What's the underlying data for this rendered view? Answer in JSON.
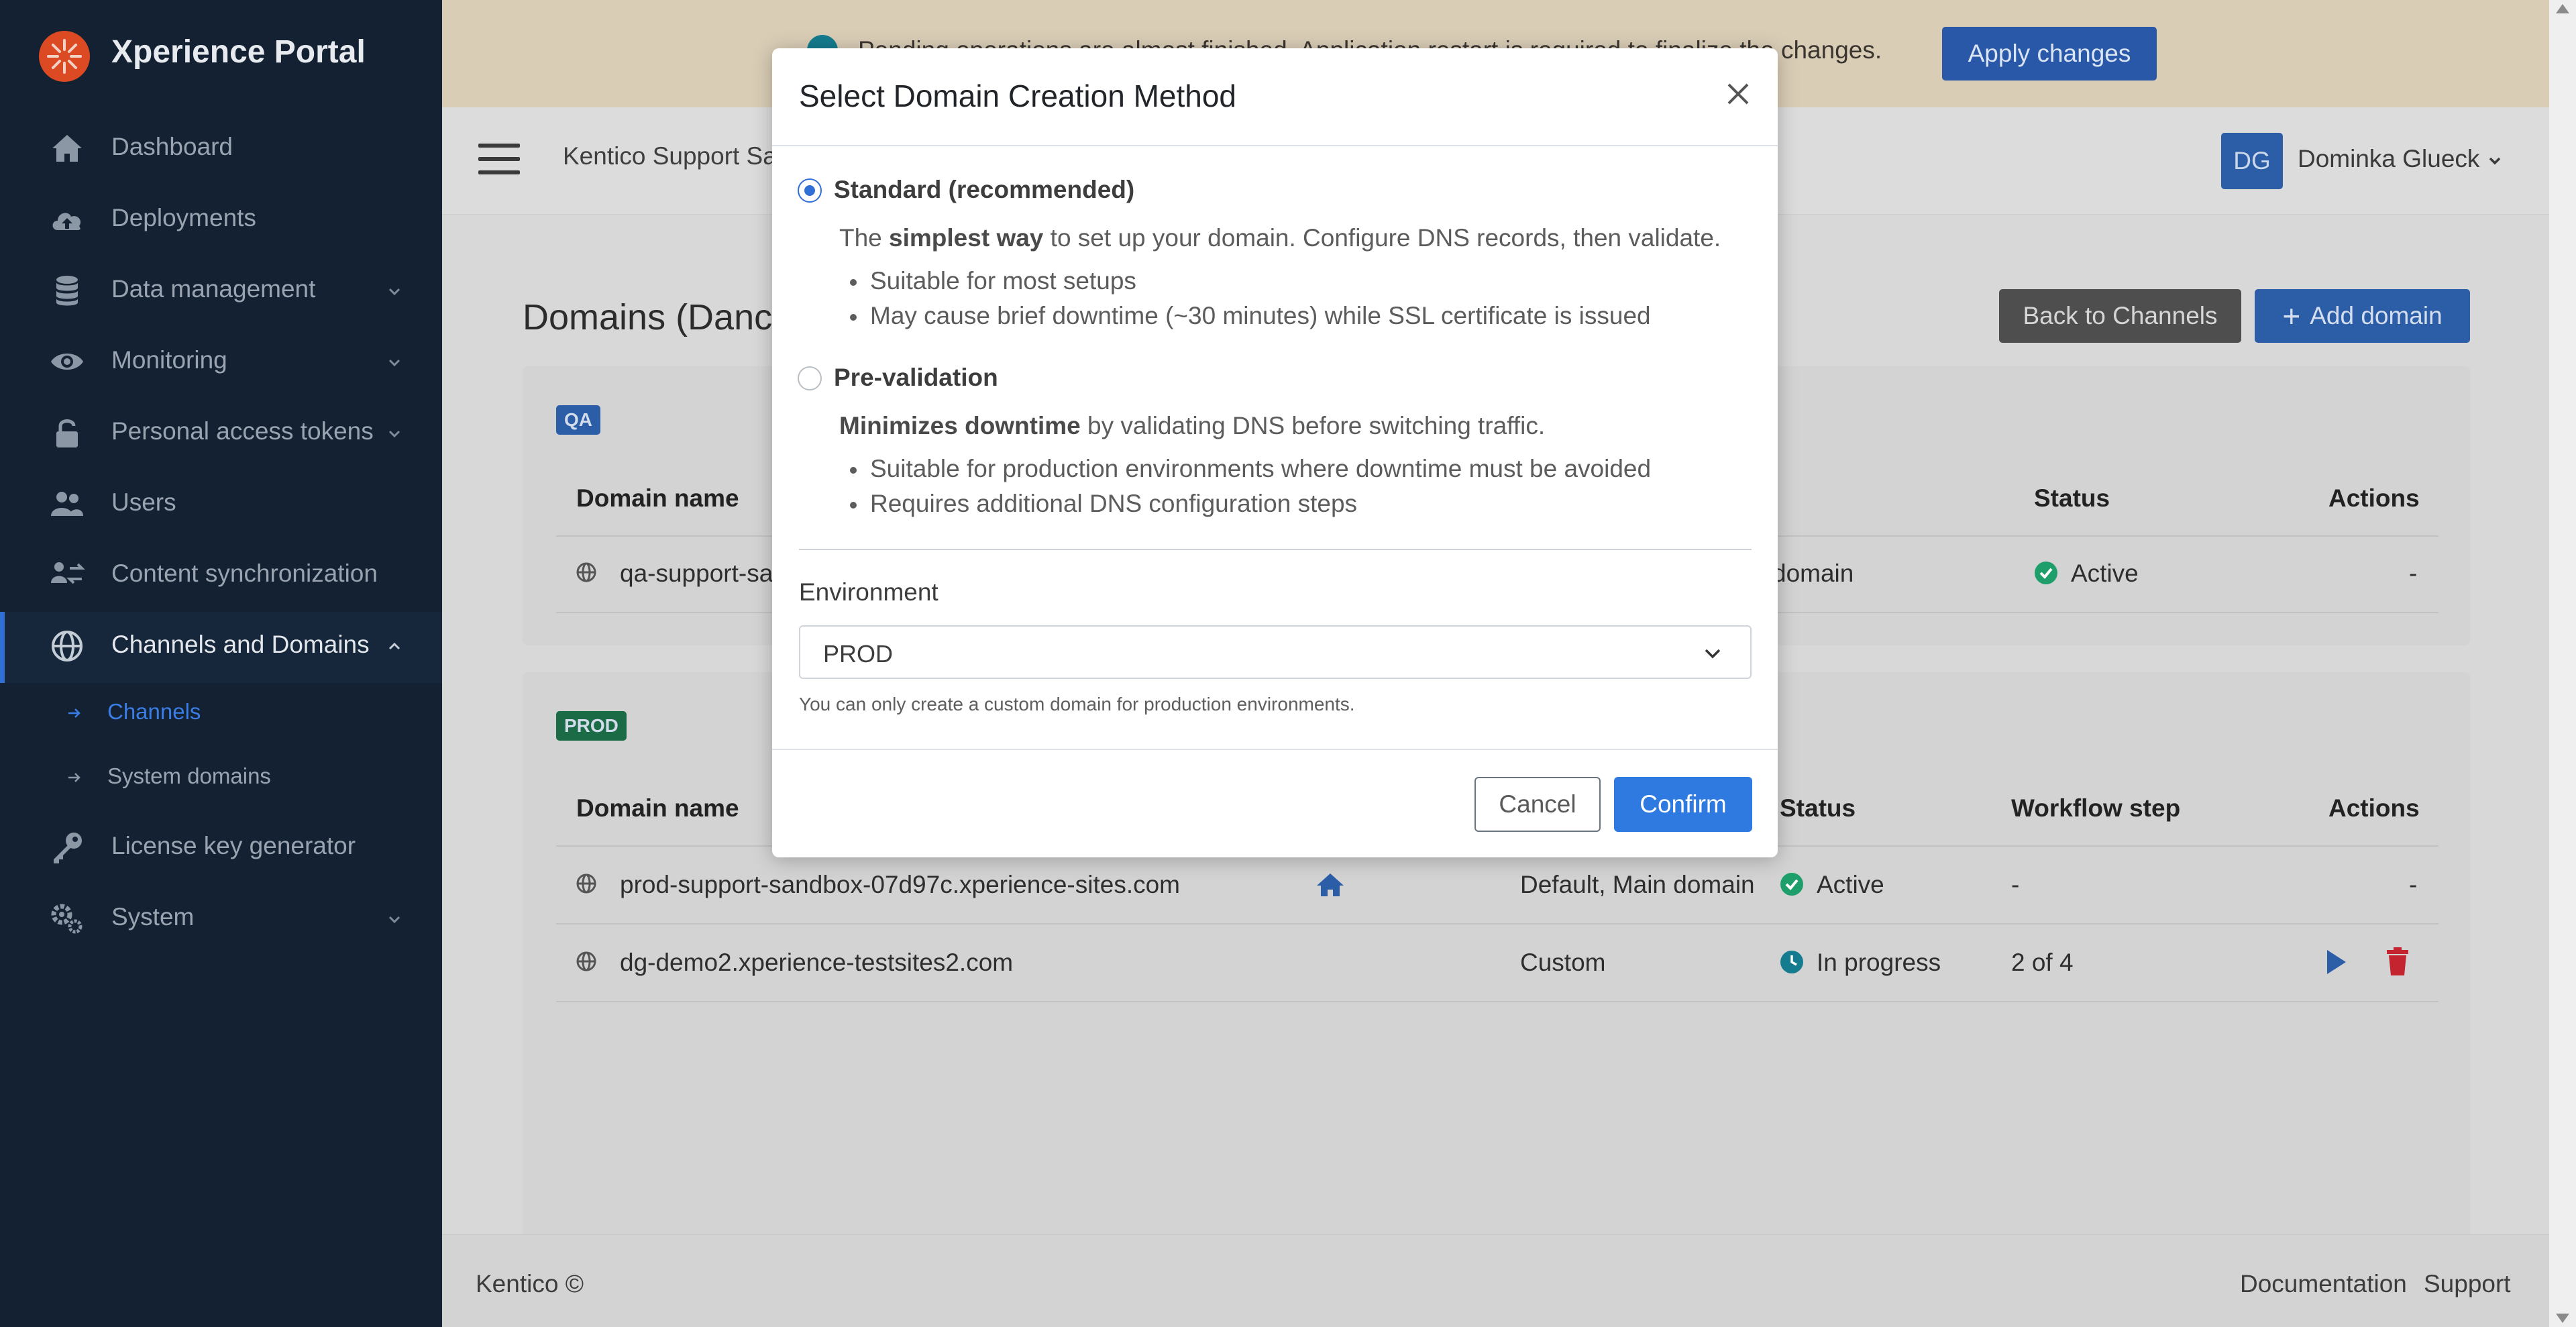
{
  "app": {
    "title": "Xperience Portal"
  },
  "sidebar": {
    "items": [
      {
        "label": "Dashboard",
        "icon": "home-icon"
      },
      {
        "label": "Deployments",
        "icon": "cloud-upload-icon"
      },
      {
        "label": "Data management",
        "icon": "database-icon"
      },
      {
        "label": "Monitoring",
        "icon": "eye-icon"
      },
      {
        "label": "Personal access tokens",
        "icon": "lock-icon"
      },
      {
        "label": "Users",
        "icon": "users-icon"
      },
      {
        "label": "Content synchronization",
        "icon": "sync-icon"
      },
      {
        "label": "Channels and Domains",
        "icon": "globe-icon"
      },
      {
        "label": "License key generator",
        "icon": "key-icon"
      },
      {
        "label": "System",
        "icon": "gears-icon"
      }
    ],
    "subitems": [
      {
        "label": "Channels"
      },
      {
        "label": "System domains"
      }
    ]
  },
  "banner": {
    "text": "Pending operations are almost finished. Application restart is required to finalize the changes.",
    "button": "Apply changes"
  },
  "header": {
    "org": "Kentico Support Sa",
    "avatar": "DG",
    "user": "Dominka Glueck"
  },
  "page": {
    "title": "Domains (Danc",
    "back_button": "Back to Channels",
    "add_button": "Add domain"
  },
  "qa": {
    "badge": "QA",
    "columns": {
      "domain": "Domain name",
      "status": "Status",
      "actions": "Actions"
    },
    "rows": [
      {
        "domain": "qa-support-sa",
        "type": "domain",
        "status": "Active",
        "actions": "-"
      }
    ]
  },
  "prod": {
    "badge": "PROD",
    "columns": {
      "domain": "Domain name",
      "status": "Status",
      "workflow": "Workflow step",
      "actions": "Actions"
    },
    "rows": [
      {
        "domain": "prod-support-sandbox-07d97c.xperience-sites.com",
        "type": "Default, Main domain",
        "status": "Active",
        "workflow": "-",
        "actions": "-"
      },
      {
        "domain": "dg-demo2.xperience-testsites2.com",
        "type": "Custom",
        "status": "In progress",
        "workflow": "2 of 4",
        "actions": ""
      }
    ]
  },
  "modal": {
    "title": "Select Domain Creation Method",
    "options": [
      {
        "label": "Standard (recommended)",
        "desc_pre": "The ",
        "desc_bold": "simplest way",
        "desc_post": " to set up your domain. Configure DNS records, then validate.",
        "bullets": [
          "Suitable for most setups",
          "May cause brief downtime (~30 minutes) while SSL certificate is issued"
        ],
        "selected": true
      },
      {
        "label": "Pre-validation",
        "desc_pre": "",
        "desc_bold": "Minimizes downtime",
        "desc_post": " by validating DNS before switching traffic.",
        "bullets": [
          "Suitable for production environments where downtime must be avoided",
          "Requires additional DNS configuration steps"
        ],
        "selected": false
      }
    ],
    "environment_label": "Environment",
    "environment_value": "PROD",
    "environment_help": "You can only create a custom domain for production environments.",
    "cancel": "Cancel",
    "confirm": "Confirm"
  },
  "footer": {
    "left": "Kentico ©",
    "links": [
      "Documentation",
      "Support"
    ]
  },
  "colors": {
    "sidebar": "#132133",
    "accent": "#2f7ae0",
    "active_status": "#1e9e6a",
    "progress_status": "#157b8f",
    "danger": "#c3242f"
  }
}
